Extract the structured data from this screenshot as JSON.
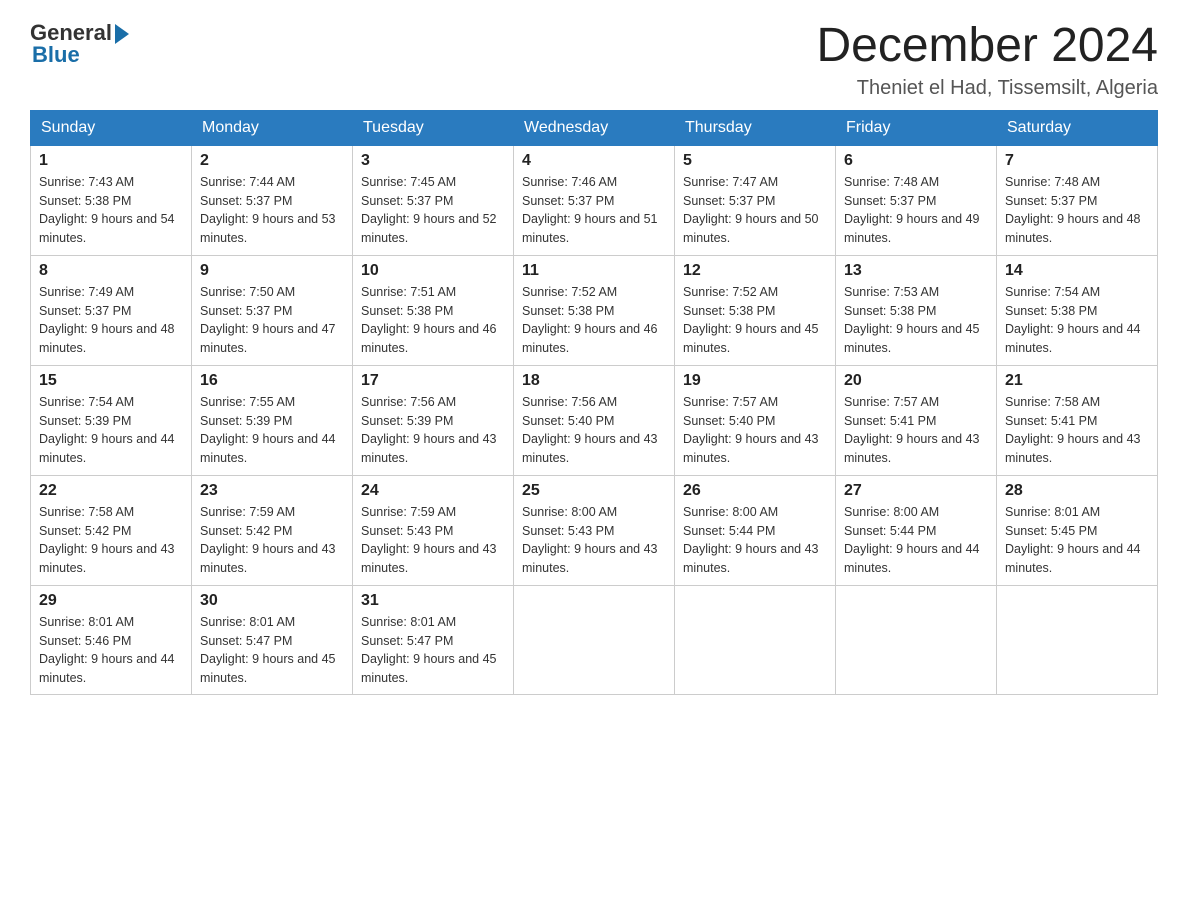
{
  "header": {
    "logo_general": "General",
    "logo_blue": "Blue",
    "month_title": "December 2024",
    "location": "Theniet el Had, Tissemsilt, Algeria"
  },
  "weekdays": [
    "Sunday",
    "Monday",
    "Tuesday",
    "Wednesday",
    "Thursday",
    "Friday",
    "Saturday"
  ],
  "weeks": [
    [
      {
        "day": "1",
        "sunrise": "7:43 AM",
        "sunset": "5:38 PM",
        "daylight": "9 hours and 54 minutes."
      },
      {
        "day": "2",
        "sunrise": "7:44 AM",
        "sunset": "5:37 PM",
        "daylight": "9 hours and 53 minutes."
      },
      {
        "day": "3",
        "sunrise": "7:45 AM",
        "sunset": "5:37 PM",
        "daylight": "9 hours and 52 minutes."
      },
      {
        "day": "4",
        "sunrise": "7:46 AM",
        "sunset": "5:37 PM",
        "daylight": "9 hours and 51 minutes."
      },
      {
        "day": "5",
        "sunrise": "7:47 AM",
        "sunset": "5:37 PM",
        "daylight": "9 hours and 50 minutes."
      },
      {
        "day": "6",
        "sunrise": "7:48 AM",
        "sunset": "5:37 PM",
        "daylight": "9 hours and 49 minutes."
      },
      {
        "day": "7",
        "sunrise": "7:48 AM",
        "sunset": "5:37 PM",
        "daylight": "9 hours and 48 minutes."
      }
    ],
    [
      {
        "day": "8",
        "sunrise": "7:49 AM",
        "sunset": "5:37 PM",
        "daylight": "9 hours and 48 minutes."
      },
      {
        "day": "9",
        "sunrise": "7:50 AM",
        "sunset": "5:37 PM",
        "daylight": "9 hours and 47 minutes."
      },
      {
        "day": "10",
        "sunrise": "7:51 AM",
        "sunset": "5:38 PM",
        "daylight": "9 hours and 46 minutes."
      },
      {
        "day": "11",
        "sunrise": "7:52 AM",
        "sunset": "5:38 PM",
        "daylight": "9 hours and 46 minutes."
      },
      {
        "day": "12",
        "sunrise": "7:52 AM",
        "sunset": "5:38 PM",
        "daylight": "9 hours and 45 minutes."
      },
      {
        "day": "13",
        "sunrise": "7:53 AM",
        "sunset": "5:38 PM",
        "daylight": "9 hours and 45 minutes."
      },
      {
        "day": "14",
        "sunrise": "7:54 AM",
        "sunset": "5:38 PM",
        "daylight": "9 hours and 44 minutes."
      }
    ],
    [
      {
        "day": "15",
        "sunrise": "7:54 AM",
        "sunset": "5:39 PM",
        "daylight": "9 hours and 44 minutes."
      },
      {
        "day": "16",
        "sunrise": "7:55 AM",
        "sunset": "5:39 PM",
        "daylight": "9 hours and 44 minutes."
      },
      {
        "day": "17",
        "sunrise": "7:56 AM",
        "sunset": "5:39 PM",
        "daylight": "9 hours and 43 minutes."
      },
      {
        "day": "18",
        "sunrise": "7:56 AM",
        "sunset": "5:40 PM",
        "daylight": "9 hours and 43 minutes."
      },
      {
        "day": "19",
        "sunrise": "7:57 AM",
        "sunset": "5:40 PM",
        "daylight": "9 hours and 43 minutes."
      },
      {
        "day": "20",
        "sunrise": "7:57 AM",
        "sunset": "5:41 PM",
        "daylight": "9 hours and 43 minutes."
      },
      {
        "day": "21",
        "sunrise": "7:58 AM",
        "sunset": "5:41 PM",
        "daylight": "9 hours and 43 minutes."
      }
    ],
    [
      {
        "day": "22",
        "sunrise": "7:58 AM",
        "sunset": "5:42 PM",
        "daylight": "9 hours and 43 minutes."
      },
      {
        "day": "23",
        "sunrise": "7:59 AM",
        "sunset": "5:42 PM",
        "daylight": "9 hours and 43 minutes."
      },
      {
        "day": "24",
        "sunrise": "7:59 AM",
        "sunset": "5:43 PM",
        "daylight": "9 hours and 43 minutes."
      },
      {
        "day": "25",
        "sunrise": "8:00 AM",
        "sunset": "5:43 PM",
        "daylight": "9 hours and 43 minutes."
      },
      {
        "day": "26",
        "sunrise": "8:00 AM",
        "sunset": "5:44 PM",
        "daylight": "9 hours and 43 minutes."
      },
      {
        "day": "27",
        "sunrise": "8:00 AM",
        "sunset": "5:44 PM",
        "daylight": "9 hours and 44 minutes."
      },
      {
        "day": "28",
        "sunrise": "8:01 AM",
        "sunset": "5:45 PM",
        "daylight": "9 hours and 44 minutes."
      }
    ],
    [
      {
        "day": "29",
        "sunrise": "8:01 AM",
        "sunset": "5:46 PM",
        "daylight": "9 hours and 44 minutes."
      },
      {
        "day": "30",
        "sunrise": "8:01 AM",
        "sunset": "5:47 PM",
        "daylight": "9 hours and 45 minutes."
      },
      {
        "day": "31",
        "sunrise": "8:01 AM",
        "sunset": "5:47 PM",
        "daylight": "9 hours and 45 minutes."
      },
      null,
      null,
      null,
      null
    ]
  ]
}
